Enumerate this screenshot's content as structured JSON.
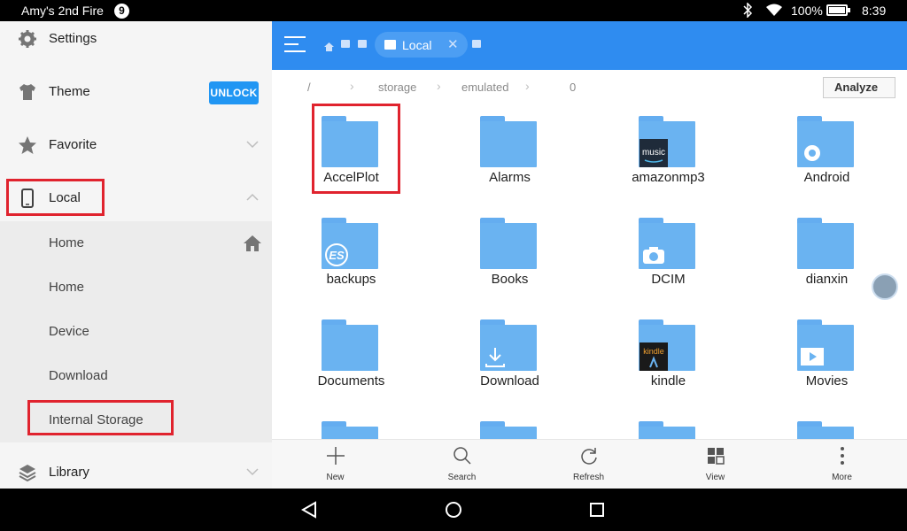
{
  "status_bar": {
    "device_name": "Amy's 2nd Fire",
    "notification_count": "9",
    "battery_percent": "100%",
    "battery_level": 1.0,
    "clock": "8:39"
  },
  "sidebar": {
    "settings_label": "Settings",
    "theme_label": "Theme",
    "unlock_label": "UNLOCK",
    "favorite_label": "Favorite",
    "local_label": "Local",
    "sub_items": [
      "Home",
      "Home",
      "Device",
      "Download",
      "Internal Storage"
    ],
    "library_label": "Library"
  },
  "toolbar": {
    "active_tab": "Local"
  },
  "path": {
    "segments": [
      "/",
      "storage",
      "emulated",
      "0"
    ],
    "analyze_label": "Analyze"
  },
  "folders": [
    {
      "name": "AccelPlot",
      "emblem": ""
    },
    {
      "name": "Alarms",
      "emblem": ""
    },
    {
      "name": "amazonmp3",
      "emblem": "music-icon"
    },
    {
      "name": "Android",
      "emblem": "gear-icon"
    },
    {
      "name": "backups",
      "emblem": "es-icon"
    },
    {
      "name": "Books",
      "emblem": ""
    },
    {
      "name": "DCIM",
      "emblem": "camera-icon"
    },
    {
      "name": "dianxin",
      "emblem": ""
    },
    {
      "name": "Documents",
      "emblem": ""
    },
    {
      "name": "Download",
      "emblem": "download-icon"
    },
    {
      "name": "kindle",
      "emblem": "kindle-icon"
    },
    {
      "name": "Movies",
      "emblem": "play-icon"
    }
  ],
  "emblem_text": {
    "music": "music",
    "kindle": "kindle"
  },
  "bottom_bar": {
    "new_label": "New",
    "search_label": "Search",
    "refresh_label": "Refresh",
    "view_label": "View",
    "more_label": "More"
  },
  "colors": {
    "accent": "#2f8cf0",
    "folder": "#6ab3f1",
    "highlight": "#e0232e",
    "unlock": "#2196f3"
  }
}
